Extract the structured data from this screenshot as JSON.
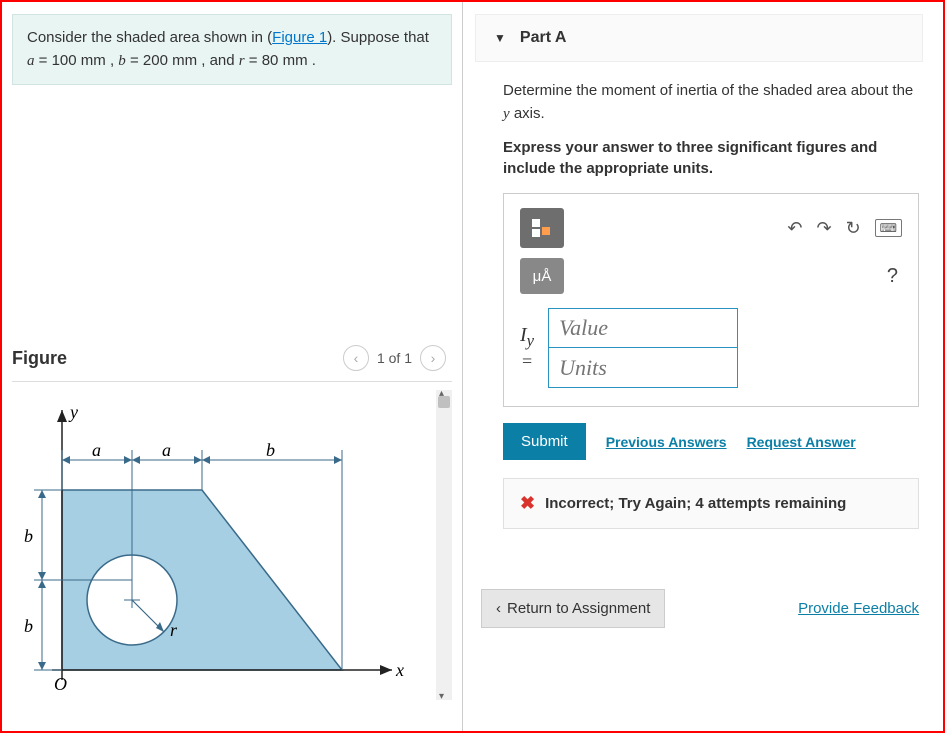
{
  "problem": {
    "intro_prefix": "Consider the shaded area shown in (",
    "figure_link": "Figure 1",
    "intro_suffix": "). Suppose that ",
    "a_var": "a",
    "a_val": " = 100  mm",
    "sep1": " , ",
    "b_var": "b",
    "b_val": " = 200  mm",
    "sep2": " , and ",
    "r_var": "r",
    "r_val": " = 80  mm",
    "period": " ."
  },
  "figure": {
    "title": "Figure",
    "pager": "1 of 1",
    "labels": {
      "y": "y",
      "x": "x",
      "O": "O",
      "a": "a",
      "b": "b",
      "r": "r"
    }
  },
  "partA": {
    "header": "Part A",
    "instruction": "Determine the moment of inertia of the shaded area about the y axis.",
    "express": "Express your answer to three significant figures and include the appropriate units.",
    "mu_label": "μÅ",
    "iy_label": "I",
    "iy_sub": "y",
    "equals": "=",
    "value_placeholder": "Value",
    "units_placeholder": "Units",
    "submit": "Submit",
    "prev_answers": "Previous Answers",
    "request_answer": "Request Answer",
    "feedback": "Incorrect; Try Again; 4 attempts remaining"
  },
  "footer": {
    "return": "Return to Assignment",
    "provide": "Provide Feedback"
  }
}
